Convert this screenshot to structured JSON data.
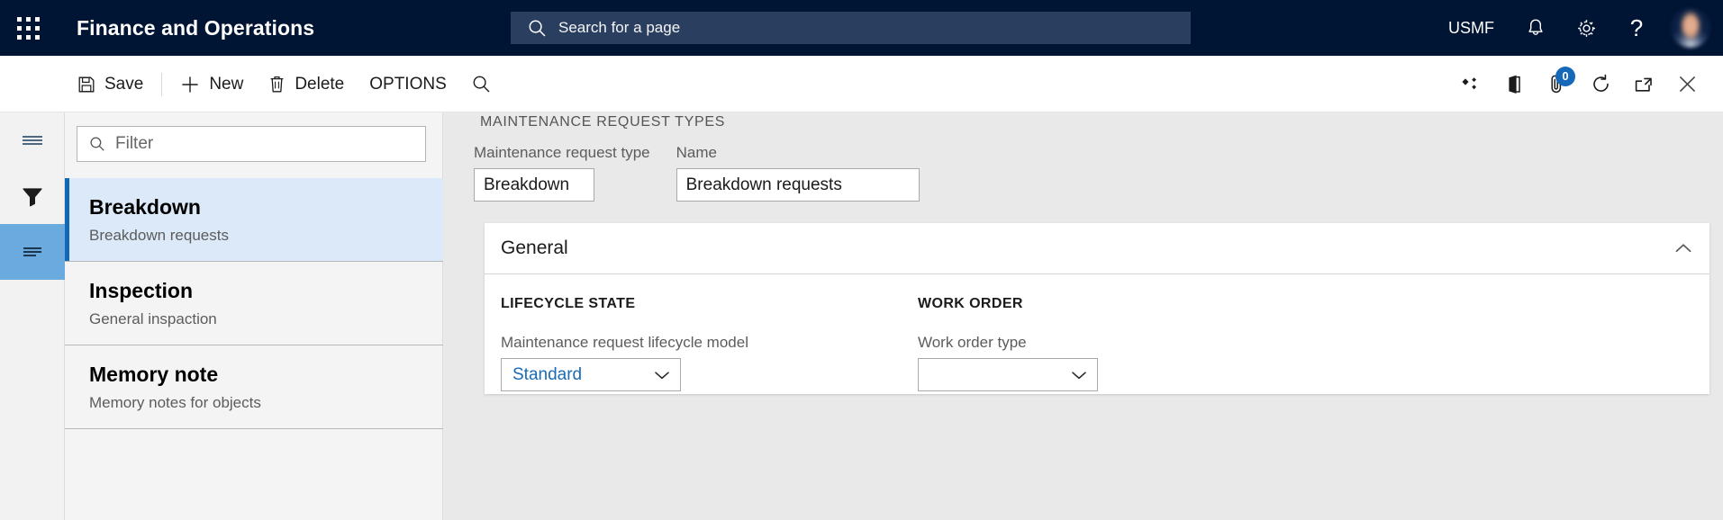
{
  "topbar": {
    "waffle_icon": "app-launcher-icon",
    "app_title": "Finance and Operations",
    "search": {
      "icon": "search-icon",
      "placeholder": "Search for a page",
      "value": ""
    },
    "company_code": "USMF",
    "notifications_icon": "bell-icon",
    "settings_icon": "gear-icon",
    "help_icon": "question-mark-icon",
    "help_glyph": "?",
    "avatar_icon": "user-avatar"
  },
  "commandbar": {
    "save_label": "Save",
    "save_icon": "save-icon",
    "new_label": "New",
    "new_icon": "plus-icon",
    "delete_label": "Delete",
    "delete_icon": "trash-icon",
    "options_label": "OPTIONS",
    "search_icon": "search-icon",
    "right_icons": [
      {
        "name": "personalize-icon"
      },
      {
        "name": "open-in-office-icon"
      },
      {
        "name": "attachments-icon",
        "badge": "0"
      },
      {
        "name": "refresh-icon"
      },
      {
        "name": "popout-icon"
      },
      {
        "name": "close-icon"
      }
    ]
  },
  "rail": {
    "items": [
      {
        "name": "navigation-pane-toggle",
        "icon": "hamburger-icon",
        "active": false
      },
      {
        "name": "filter-pane-toggle",
        "icon": "funnel-icon",
        "active": false
      },
      {
        "name": "list-pane-toggle",
        "icon": "list-icon",
        "active": true
      }
    ]
  },
  "listpane": {
    "filter": {
      "icon": "search-icon",
      "placeholder": "Filter",
      "value": ""
    },
    "items": [
      {
        "title": "Breakdown",
        "subtitle": "Breakdown requests",
        "selected": true
      },
      {
        "title": "Inspection",
        "subtitle": "General inspaction",
        "selected": false
      },
      {
        "title": "Memory note",
        "subtitle": "Memory notes for objects",
        "selected": false
      }
    ]
  },
  "content": {
    "page_caption": "MAINTENANCE REQUEST TYPES",
    "header_fields": [
      {
        "label": "Maintenance request type",
        "value": "Breakdown"
      },
      {
        "label": "Name",
        "value": "Breakdown requests"
      }
    ],
    "card": {
      "title": "General",
      "collapse_icon": "chevron-up-icon",
      "columns": [
        {
          "heading": "LIFECYCLE STATE",
          "field_label": "Maintenance request lifecycle model",
          "field_value": "Standard",
          "dropdown_icon": "chevron-down-icon"
        },
        {
          "heading": "WORK ORDER",
          "field_label": "Work order type",
          "field_value": "",
          "dropdown_icon": "chevron-down-icon"
        }
      ]
    }
  },
  "colors": {
    "header_navy": "#001433",
    "search_field": "#2a3f5f",
    "accent_blue": "#1268b3",
    "selection_fill": "#dbe9f8",
    "rail_active": "#6aaade",
    "badge_blue": "#1668b8",
    "link_blue": "#1a6ab5",
    "body_gray": "#e9e9e9"
  }
}
